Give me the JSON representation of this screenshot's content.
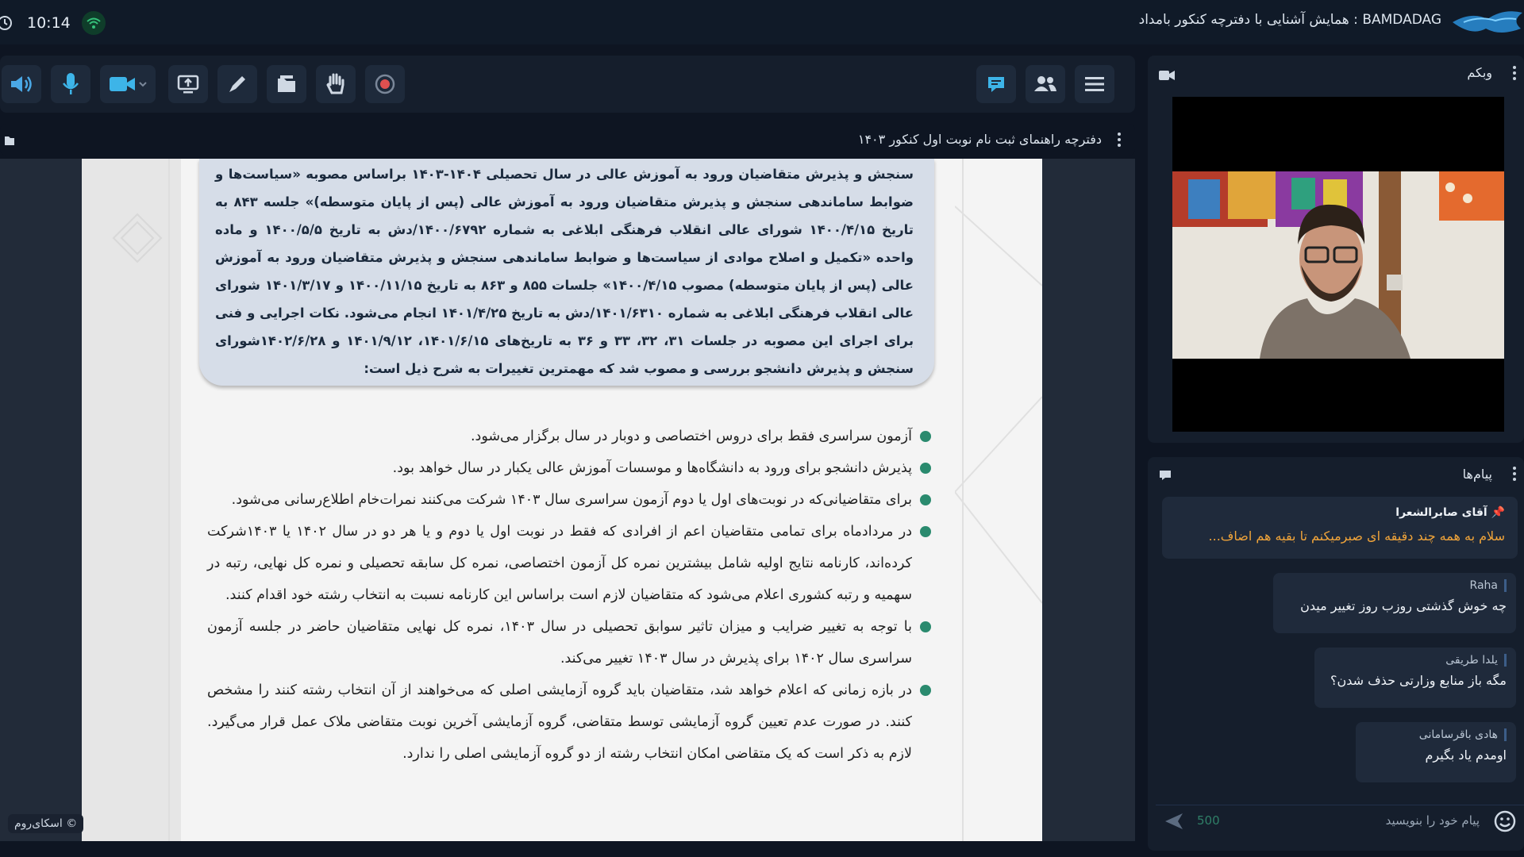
{
  "header": {
    "time": "10:14",
    "title": "BAMDADAG : همایش آشنایی با دفترچه کنکور بامداد"
  },
  "document": {
    "title": "دفترچه راهنمای ثبت نام نوبت اول کنکور ۱۴۰۳",
    "summary": "سنجش و پذیرش متقاضیان ورود به آموزش عالی در سال تحصیلی ۱۴۰۴-۱۴۰۳ براساس مصوبه «سیاست‌ها و ضوابط ساماندهی سنجش و پذیرش متقاضیان ورود به آموزش عالی (پس از پایان متوسطه)» جلسه ۸۴۳ به تاریخ ۱۴۰۰/۴/۱۵ شورای عالی انقلاب فرهنگی ابلاغی به شماره ۱۴۰۰/۶۷۹۲/دش به تاریخ ۱۴۰۰/۵/۵ و ماده واحده «تکمیل و اصلاح موادی از سیاست‌ها و ضوابط ساماندهی سنجش و پذیرش متقاضیان ورود به آموزش عالی (پس از پایان متوسطه) مصوب ۱۴۰۰/۴/۱۵» جلسات ۸۵۵ و ۸۶۳ به تاریخ ۱۴۰۰/۱۱/۱۵ و ۱۴۰۱/۳/۱۷ شورای عالی انقلاب فرهنگی ابلاغی به شماره ۱۴۰۱/۶۳۱۰/دش به تاریخ ۱۴۰۱/۴/۲۵ انجام می‌شود. نکات اجرایی و فنی برای اجرای این مصوبه در جلسات ۳۱، ۳۲، ۳۳ و ۳۶ به تاریخ‌های ۱۴۰۱/۶/۱۵، ۱۴۰۱/۹/۱۲ و ۱۴۰۲/۶/۲۸شورای سنجش و پذیرش دانشجو بررسی و مصوب شد که مهمترین تغییرات به شرح ذیل است:",
    "bullets": [
      "آزمون سراسری فقط برای دروس اختصاصی و دوبار در سال برگزار می‌شود.",
      "پذیرش دانشجو برای ورود به دانشگاه‌ها و موسسات آموزش عالی یکبار در سال خواهد بود.",
      "برای متقاضیانی‌که در نوبت‌های اول یا دوم آزمون سراسری سال ۱۴۰۳ شرکت می‌کنند نمرات‌خام اطلاع‌رسانی می‌شود.",
      "در مردادماه برای تمامی متقاضیان اعم از افرادی که فقط در نوبت اول یا دوم و یا هر دو در سال ۱۴۰۲ یا ۱۴۰۳شرکت کرده‌اند، کارنامه نتایج اولیه شامل بیشترین نمره کل آزمون اختصاصی، نمره کل سابقه تحصیلی و نمره کل نهایی، رتبه در سهمیه و رتبه کشوری اعلام می‌شود که متقاضیان لازم است براساس این کارنامه نسبت به انتخاب رشته خود اقدام کنند.",
      "با توجه به تغییر ضرایب و میزان تاثیر سوابق تحصیلی در سال ۱۴۰۳، نمره کل نهایی متقاضیان حاضر در جلسه آزمون سراسری سال ۱۴۰۲ برای پذیرش در سال ۱۴۰۳ تغییر می‌کند.",
      "در بازه زمانی که اعلام خواهد شد، متقاضیان باید گروه آزمایشی اصلی که می‌خواهند از آن انتخاب رشته کنند را مشخص کنند. در صورت عدم تعیین گروه آزمایشی توسط متقاضی، گروه آزمایشی آخرین نوبت متقاضی ملاک عمل قرار می‌گیرد. لازم به ذکر است که یک متقاضی امکان انتخاب رشته از دو گروه آزمایشی اصلی را ندارد."
    ],
    "watermark": "© اسکای‌روم"
  },
  "webcam": {
    "title": "وبکم"
  },
  "chat": {
    "title": "پیام‌ها",
    "pinned": {
      "name": "آقای صابرالشعرا",
      "text": "سلام به همه چند دقیقه ای صبرمیکنم تا بقیه هم اضاف..."
    },
    "messages": [
      {
        "name": "Raha",
        "text": "چه خوش گذشتی روزب روز تغییر میدن"
      },
      {
        "name": "یلدا طریقی",
        "text": "مگه باز منابع وزارتی حذف شدن؟"
      },
      {
        "name": "هادی باقرسامانی",
        "text": "اومدم یاد بگیرم"
      }
    ],
    "input_placeholder": "پیام خود را بنویسید",
    "char_limit": "500"
  },
  "colors": {
    "accent": "#2a8a6e",
    "pinned_text": "#f0a43a",
    "speaker_icon": "#4aa8e6",
    "camera_icon": "#3db4e8",
    "record_dot": "#e05050"
  }
}
